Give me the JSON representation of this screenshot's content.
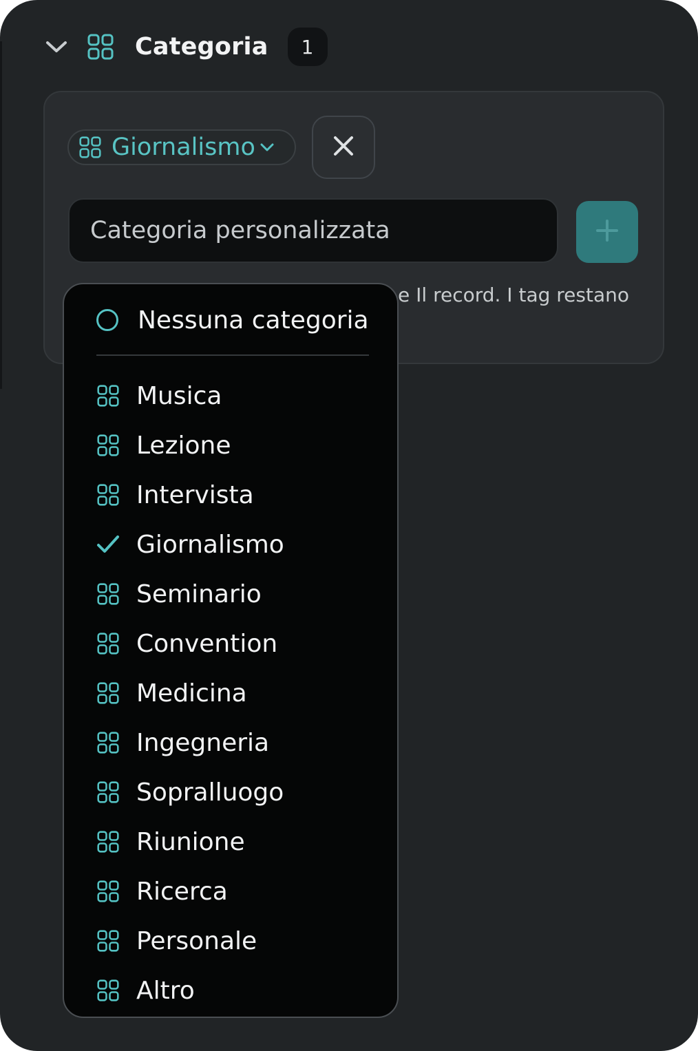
{
  "section": {
    "title": "Categoria",
    "count": "1",
    "chevron_icon": "chevron-down-icon",
    "icon": "grid-icon"
  },
  "selected_chip": {
    "label": "Giornalismo",
    "icon": "grid-icon",
    "caret_icon": "chevron-down-icon"
  },
  "remove_button": {
    "icon": "close-icon"
  },
  "custom_input": {
    "placeholder": "Categoria personalizzata",
    "value": ""
  },
  "add_button": {
    "icon": "plus-icon"
  },
  "hint_text": "e Il record. I tag restano",
  "dropdown": {
    "none_option": {
      "label": "Nessuna categoria",
      "icon": "circle-icon"
    },
    "items": [
      {
        "label": "Musica",
        "icon": "grid-icon"
      },
      {
        "label": "Lezione",
        "icon": "grid-icon"
      },
      {
        "label": "Intervista",
        "icon": "grid-icon"
      },
      {
        "label": "Giornalismo",
        "icon": "checkmark-icon",
        "selected": true
      },
      {
        "label": "Seminario",
        "icon": "grid-icon"
      },
      {
        "label": "Convention",
        "icon": "grid-icon"
      },
      {
        "label": "Medicina",
        "icon": "grid-icon"
      },
      {
        "label": "Ingegneria",
        "icon": "grid-icon"
      },
      {
        "label": "Sopralluogo",
        "icon": "grid-icon"
      },
      {
        "label": "Riunione",
        "icon": "grid-icon"
      },
      {
        "label": "Ricerca",
        "icon": "grid-icon"
      },
      {
        "label": "Personale",
        "icon": "grid-icon"
      },
      {
        "label": "Altro",
        "icon": "grid-icon"
      }
    ]
  },
  "colors": {
    "accent": "#55c2c3",
    "background": "#212426",
    "panel": "#292c2f",
    "dropdown_bg": "#050606",
    "add_button": "#2f7a7c"
  }
}
